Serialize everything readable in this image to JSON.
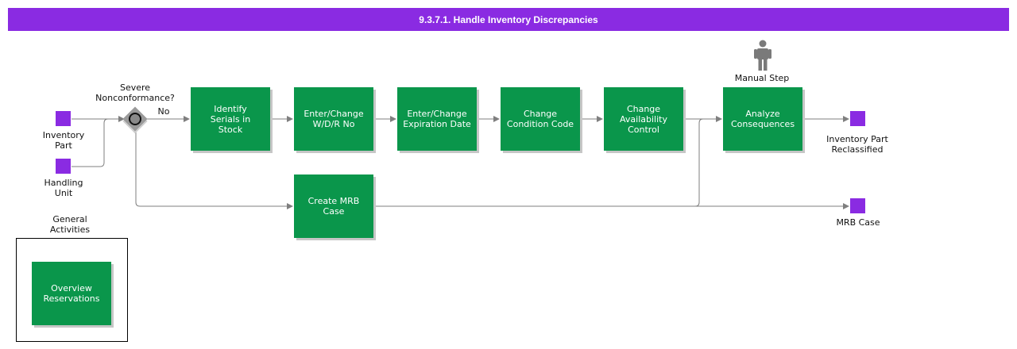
{
  "title": "9.3.7.1. Handle Inventory Discrepancies",
  "activities": {
    "identify_serials": "Identify\nSerials in\nStock",
    "enter_wdr": "Enter/Change\nW/D/R No",
    "enter_expiration": "Enter/Change\nExpiration Date",
    "change_condition": "Change\nCondition Code",
    "change_availability": "Change\nAvailability\nControl",
    "analyze_consequences": "Analyze\nConsequences",
    "create_mrb_case": "Create MRB\nCase",
    "overview_reservations": "Overview\nReservations"
  },
  "objects": {
    "inventory_part": "Inventory\nPart",
    "handling_unit": "Handling\nUnit",
    "inventory_part_reclassified": "Inventory Part\nReclassified",
    "mrb_case": "MRB Case"
  },
  "gateway": {
    "question": "Severe\nNonconformance?",
    "no_label": "No"
  },
  "manual_step_label": "Manual Step",
  "general_activities_label": "General\nActivities",
  "colors": {
    "title_bar": "#8a2be2",
    "activity": "#0a964b",
    "data_object": "#8a2be2",
    "connector": "#7f7f7f"
  }
}
